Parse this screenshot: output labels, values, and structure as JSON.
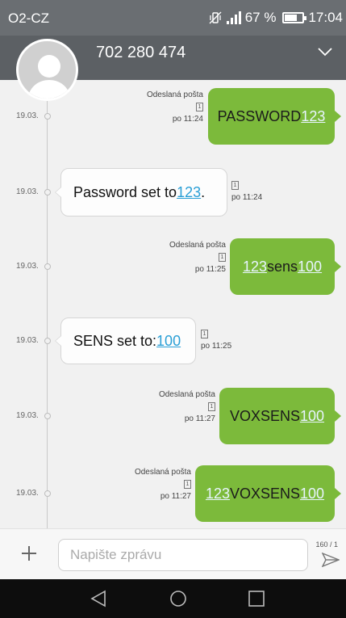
{
  "status": {
    "carrier": "O2-CZ",
    "battery_percent": "67 %",
    "time": "17:04",
    "battery_fill": 0.67
  },
  "header": {
    "contact_number": "702 280 474"
  },
  "messages": [
    {
      "direction": "out",
      "date": "19.03.",
      "status": "Odeslaná pošta",
      "sim": "1",
      "time": "po 11:24",
      "parts": [
        {
          "text": "PASSWORD",
          "link": false
        },
        {
          "text": "123",
          "link": true
        }
      ]
    },
    {
      "direction": "in",
      "date": "19.03.",
      "sim": "1",
      "time": "po 11:24",
      "parts": [
        {
          "text": "Password set to ",
          "link": false
        },
        {
          "text": "123",
          "link": true
        },
        {
          "text": ".",
          "link": false
        }
      ]
    },
    {
      "direction": "out",
      "date": "19.03.",
      "status": "Odeslaná pošta",
      "sim": "1",
      "time": "po 11:25",
      "parts": [
        {
          "text": "123",
          "link": true
        },
        {
          "text": "sens",
          "link": false
        },
        {
          "text": "100",
          "link": true
        }
      ]
    },
    {
      "direction": "in",
      "date": "19.03.",
      "sim": "1",
      "time": "po 11:25",
      "parts": [
        {
          "text": "SENS set to: ",
          "link": false
        },
        {
          "text": "100",
          "link": true
        }
      ]
    },
    {
      "direction": "out",
      "date": "19.03.",
      "status": "Odeslaná pošta",
      "sim": "1",
      "time": "po 11:27",
      "parts": [
        {
          "text": "VOXSENS",
          "link": false
        },
        {
          "text": "100",
          "link": true
        }
      ]
    },
    {
      "direction": "out",
      "date": "19.03.",
      "status": "Odeslaná pošta",
      "sim": "1",
      "time": "po 11:27",
      "parts": [
        {
          "text": "123",
          "link": true
        },
        {
          "text": "VOXSENS",
          "link": false
        },
        {
          "text": "100",
          "link": true
        }
      ]
    }
  ],
  "compose": {
    "placeholder": "Napište zprávu",
    "counter": "160 / 1"
  },
  "icons": {
    "vibrate": "vibrate-icon",
    "signal": "signal-icon",
    "battery": "battery-icon",
    "chevron": "chevron-down-icon",
    "add": "plus-icon",
    "send": "send-icon",
    "back": "back-icon",
    "home": "home-icon",
    "recents": "recents-icon"
  },
  "colors": {
    "outgoing_bubble": "#7cba3b",
    "incoming_bubble": "#fdfdfd",
    "link_in": "#2a9fd6",
    "header": "#5c6064"
  }
}
